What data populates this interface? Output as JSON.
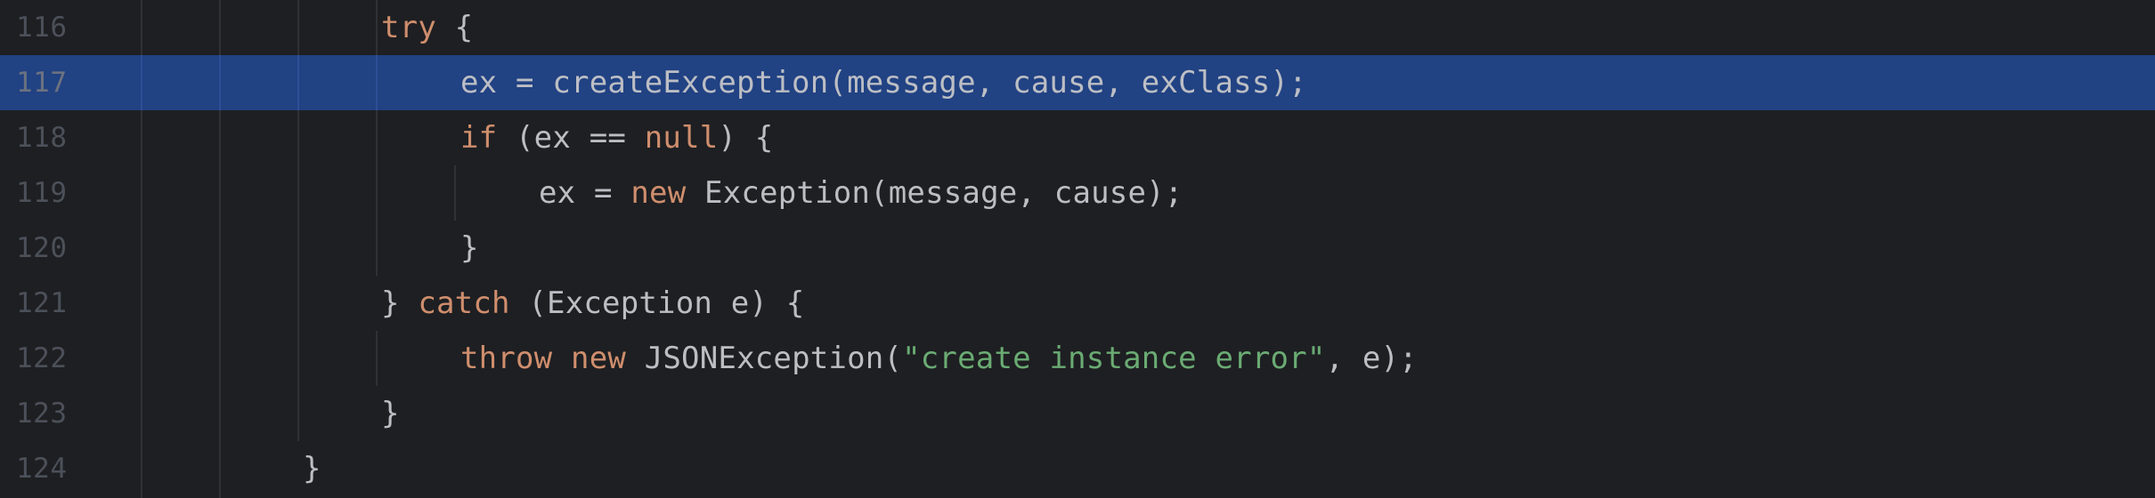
{
  "editor": {
    "selected_line": 117,
    "colors": {
      "background": "#1e1f22",
      "selection": "#214283",
      "keyword": "#cf8e6d",
      "string": "#6aab73",
      "text": "#bcbec4",
      "line_number": "#4b5059"
    },
    "lines": [
      {
        "number": "116",
        "tokens": [
          {
            "t": "try",
            "k": "kw"
          },
          {
            "t": " {",
            "k": "plain"
          }
        ]
      },
      {
        "number": "117",
        "tokens": [
          {
            "t": "ex = createException(message, cause, exClass);",
            "k": "plain"
          }
        ]
      },
      {
        "number": "118",
        "tokens": [
          {
            "t": "if",
            "k": "kw"
          },
          {
            "t": " (ex == ",
            "k": "plain"
          },
          {
            "t": "null",
            "k": "kw"
          },
          {
            "t": ") {",
            "k": "plain"
          }
        ]
      },
      {
        "number": "119",
        "tokens": [
          {
            "t": "ex = ",
            "k": "plain"
          },
          {
            "t": "new",
            "k": "kw"
          },
          {
            "t": " Exception(message, cause);",
            "k": "plain"
          }
        ]
      },
      {
        "number": "120",
        "tokens": [
          {
            "t": "}",
            "k": "plain"
          }
        ]
      },
      {
        "number": "121",
        "tokens": [
          {
            "t": "} ",
            "k": "plain"
          },
          {
            "t": "catch",
            "k": "kw"
          },
          {
            "t": " (Exception e) {",
            "k": "plain"
          }
        ]
      },
      {
        "number": "122",
        "tokens": [
          {
            "t": "throw",
            "k": "kw"
          },
          {
            "t": " ",
            "k": "plain"
          },
          {
            "t": "new",
            "k": "kw"
          },
          {
            "t": " JSONException(",
            "k": "plain"
          },
          {
            "t": "\"create instance error\"",
            "k": "str"
          },
          {
            "t": ", e);",
            "k": "plain"
          }
        ]
      },
      {
        "number": "123",
        "tokens": [
          {
            "t": "}",
            "k": "plain"
          }
        ]
      },
      {
        "number": "124",
        "tokens": [
          {
            "t": "}",
            "k": "plain"
          }
        ]
      }
    ]
  }
}
